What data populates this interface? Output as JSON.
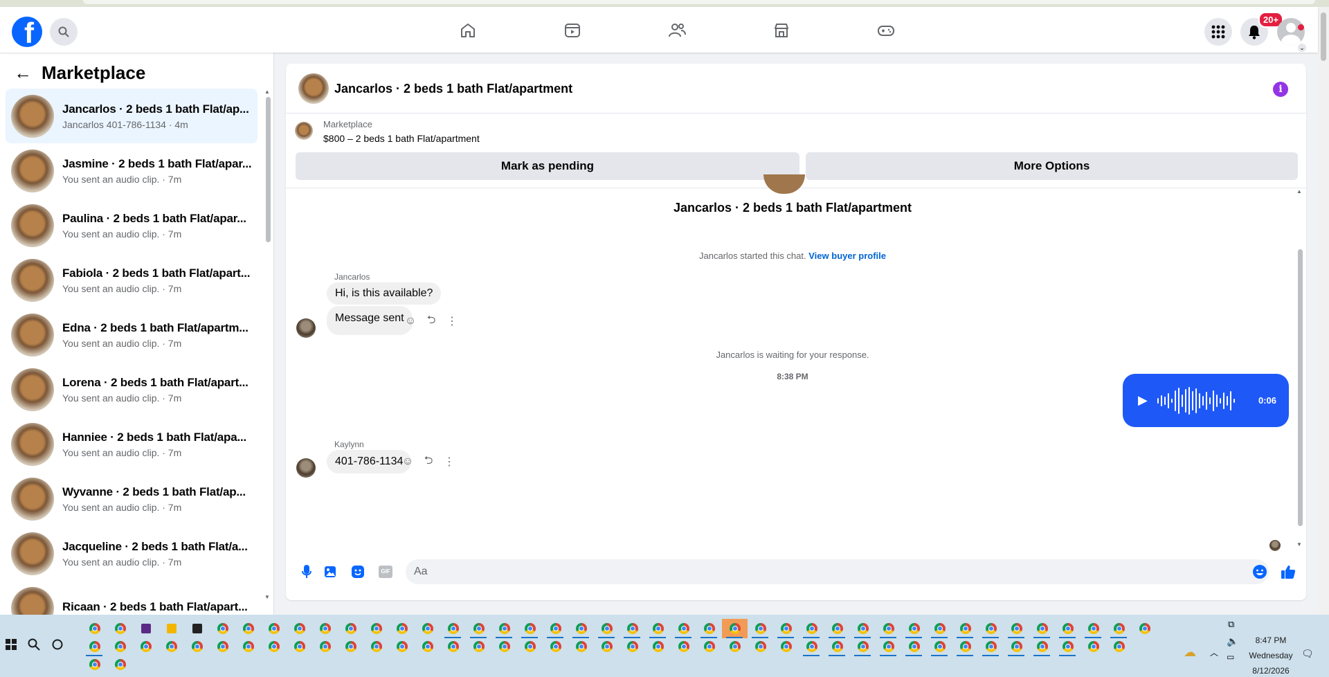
{
  "header": {
    "logo_letter": "f",
    "notifications_badge": "20+",
    "nav": [
      {
        "name": "home-icon"
      },
      {
        "name": "video-icon"
      },
      {
        "name": "friends-icon"
      },
      {
        "name": "marketplace-icon"
      },
      {
        "name": "gaming-icon"
      }
    ]
  },
  "sidebar": {
    "back_label": "←",
    "title": "Marketplace",
    "conversations": [
      {
        "name": "Jancarlos · 2 beds 1 bath Flat/ap...",
        "sub": "Jancarlos 401-786-1134 · 4m",
        "active": true
      },
      {
        "name": "Jasmine · 2 beds 1 bath Flat/apar...",
        "sub": "You sent an audio clip. · 7m"
      },
      {
        "name": "Paulina · 2 beds 1 bath Flat/apar...",
        "sub": "You sent an audio clip. · 7m"
      },
      {
        "name": "Fabiola · 2 beds 1 bath Flat/apart...",
        "sub": "You sent an audio clip. · 7m"
      },
      {
        "name": "Edna · 2 beds 1 bath Flat/apartm...",
        "sub": "You sent an audio clip. · 7m"
      },
      {
        "name": "Lorena · 2 beds 1 bath Flat/apart...",
        "sub": "You sent an audio clip. · 7m"
      },
      {
        "name": "Hanniee · 2 beds 1 bath Flat/apa...",
        "sub": "You sent an audio clip. · 7m"
      },
      {
        "name": "Wyvanne · 2 beds 1 bath Flat/ap...",
        "sub": "You sent an audio clip. · 7m"
      },
      {
        "name": "Jacqueline · 2 beds 1 bath Flat/a...",
        "sub": "You sent an audio clip. · 7m"
      },
      {
        "name": "Ricaan · 2 beds 1 bath Flat/apart...",
        "sub": ""
      }
    ]
  },
  "chat": {
    "title": "Jancarlos · 2 beds 1 bath Flat/apartment",
    "info_label": "i",
    "listing": {
      "category": "Marketplace",
      "price_title": "$800 – 2 beds 1 bath Flat/apartment",
      "pending_label": "Mark as pending",
      "more_label": "More Options"
    },
    "convo_title": "Jancarlos · 2 beds 1 bath Flat/apartment",
    "started_text": "Jancarlos started this chat.",
    "view_profile": "View buyer profile",
    "sender1": "Jancarlos",
    "msg1": "Hi, is this available?",
    "msg2": "Message sent",
    "waiting_text": "Jancarlos is waiting for your response.",
    "timestamp": "8:38 PM",
    "audio_duration": "0:06",
    "sender2": "Kaylynn",
    "msg3": "401-786-1134",
    "composer_placeholder": "Aa"
  },
  "taskbar": {
    "time": "8:47 PM",
    "day": "Wednesday",
    "date": "8/12/2026"
  },
  "colors": {
    "brand": "#0866ff",
    "audio_bubble": "#1e58f7",
    "active_conversation": "#ebf5ff",
    "info": "#9334e6",
    "badge": "#e41e3f"
  }
}
